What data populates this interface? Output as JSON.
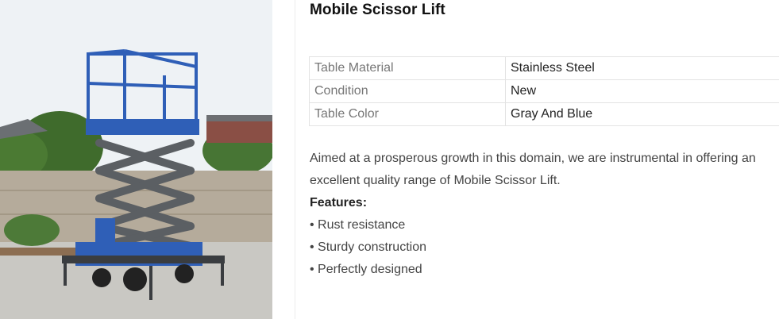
{
  "product": {
    "title": "Mobile Scissor Lift",
    "image_alt": "Mobile Scissor Lift"
  },
  "specs": [
    {
      "label": "Table Material",
      "value": "Stainless Steel"
    },
    {
      "label": "Condition",
      "value": "New"
    },
    {
      "label": "Table Color",
      "value": "Gray And Blue"
    }
  ],
  "description": {
    "text": "Aimed at a prosperous growth in this domain, we are instrumental in offering an excellent quality range of Mobile Scissor Lift.",
    "features_title": "Features:",
    "features": [
      "• Rust resistance",
      "• Sturdy construction",
      "• Perfectly designed"
    ]
  },
  "colors": {
    "lift_blue": "#2f5fb7",
    "scissor_gray": "#5b5f63"
  }
}
